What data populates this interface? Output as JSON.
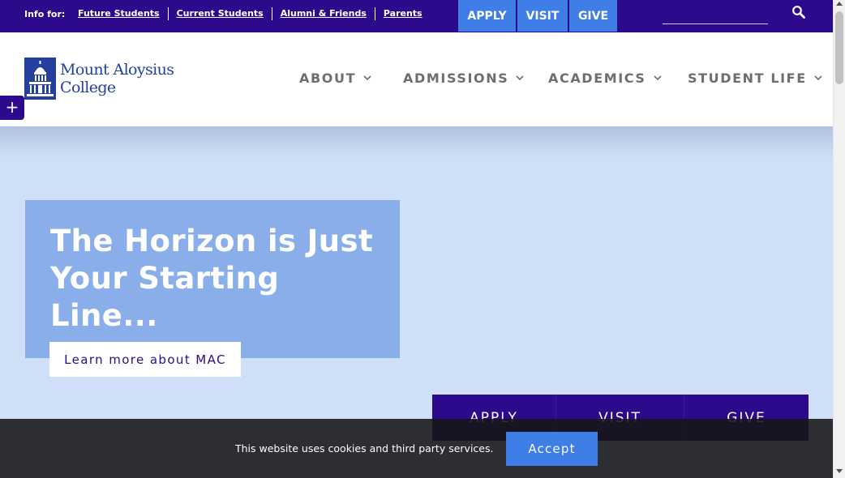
{
  "utility_bar": {
    "info_label": "Info for:",
    "links": [
      "Future Students",
      "Current Students",
      "Alumni & Friends",
      "Parents"
    ],
    "cta": {
      "apply": "APPLY",
      "visit": "VISIT",
      "give": "GIVE"
    },
    "search": {
      "value": "",
      "placeholder": "",
      "icon": "search-icon"
    }
  },
  "header": {
    "logo": {
      "line1": "Mount Aloysius",
      "line2": "College",
      "icon": "college-dome-logo"
    },
    "nav": [
      {
        "label": "ABOUT",
        "icon": "chevron-down-icon"
      },
      {
        "label": "ADMISSIONS",
        "icon": "chevron-down-icon"
      },
      {
        "label": "ACADEMICS",
        "icon": "chevron-down-icon"
      },
      {
        "label": "STUDENT LIFE",
        "icon": "chevron-down-icon"
      }
    ]
  },
  "side_toggle": {
    "label": "+"
  },
  "hero": {
    "title": "The Horizon is Just Your Starting Line...",
    "button_label": "Learn more about MAC",
    "cta_bar": {
      "apply": "APPLY",
      "visit": "VISIT",
      "give": "GIVE"
    }
  },
  "cookie_banner": {
    "text": "This website uses cookies and third party services.",
    "accept_label": "Accept"
  },
  "colors": {
    "brand_purple": "#2d0a8c",
    "accent_blue": "#3e7ee6",
    "hero_bg": "#cfdff7",
    "hero_card": "#8aaeea",
    "logo_blue": "#24409c"
  }
}
